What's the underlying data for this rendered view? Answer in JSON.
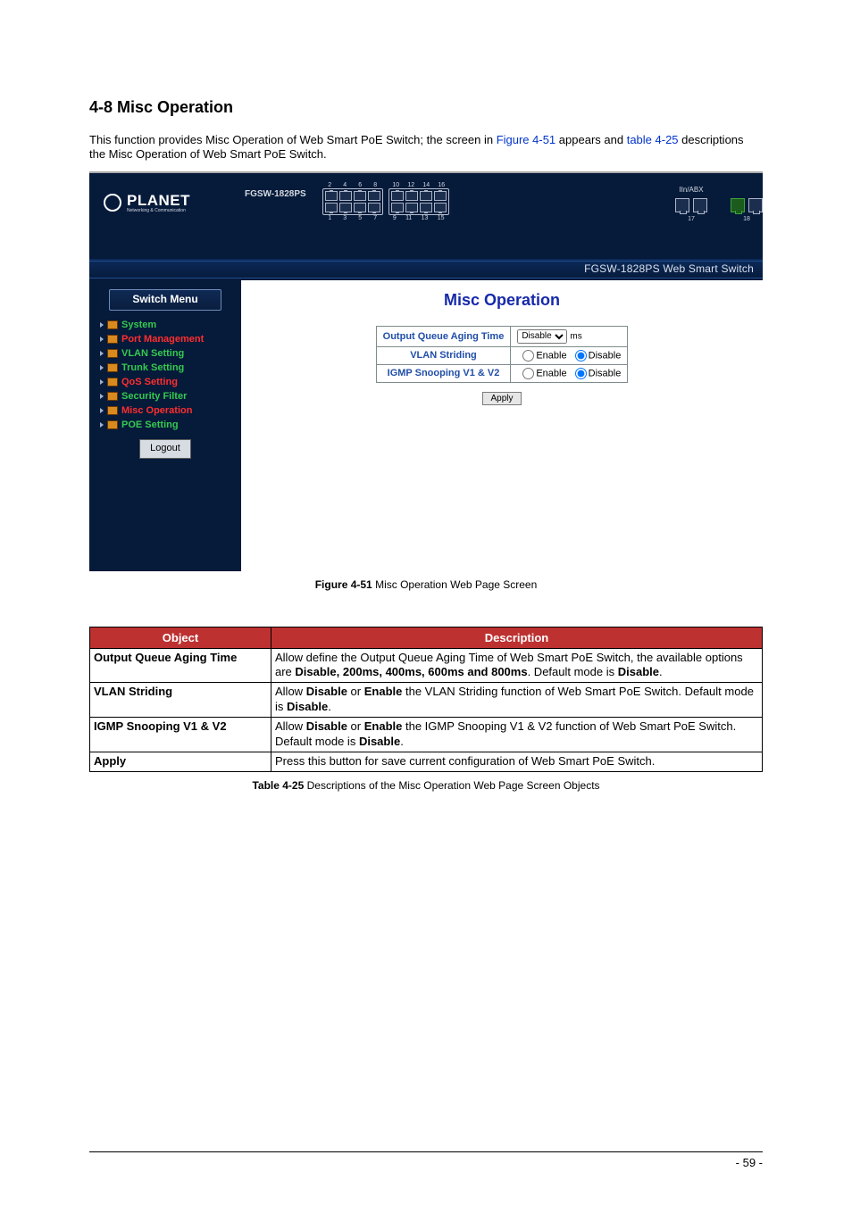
{
  "heading": "4-8 Misc Operation",
  "intro": {
    "before_fig": "This function provides Misc Operation of Web Smart PoE Switch; the screen in ",
    "fig_link": "Figure 4-51",
    "mid": " appears and ",
    "tbl_link": "table 4-25",
    "after": " descriptions the Misc Operation of Web Smart PoE Switch."
  },
  "screenshot": {
    "model": "FGSW-1828PS",
    "brand": "PLANET",
    "brand_sub": "Networking & Communication",
    "link_label": "IIn/ABX",
    "port_nums_top_a": [
      "2",
      "4",
      "6",
      "8"
    ],
    "port_nums_top_b": [
      "10",
      "12",
      "14",
      "16"
    ],
    "port_nums_bot_a": [
      "1",
      "3",
      "5",
      "7"
    ],
    "port_nums_bot_b": [
      "9",
      "11",
      "13",
      "15"
    ],
    "uplink_left": "17",
    "uplink_right": "18",
    "strip_title": "FGSW-1828PS Web Smart Switch",
    "menu_title": "Switch Menu",
    "menu_items": [
      {
        "label": "System",
        "class": "green"
      },
      {
        "label": "Port Management",
        "class": "red"
      },
      {
        "label": "VLAN Setting",
        "class": "green"
      },
      {
        "label": "Trunk Setting",
        "class": "green"
      },
      {
        "label": "QoS Setting",
        "class": "red"
      },
      {
        "label": "Security Filter",
        "class": "green"
      },
      {
        "label": "Misc Operation",
        "class": "red"
      },
      {
        "label": "POE Setting",
        "class": "green"
      }
    ],
    "logout": "Logout",
    "content_title": "Misc Operation",
    "rows": {
      "aging_label": "Output Queue Aging Time",
      "aging_select": "Disable",
      "aging_unit": "ms",
      "vlan_label": "VLAN Striding",
      "igmp_label": "IGMP Snooping V1 & V2",
      "enable": "Enable",
      "disable": "Disable"
    },
    "apply": "Apply"
  },
  "fig_caption_bold": "Figure 4-51",
  "fig_caption_rest": " Misc Operation Web Page Screen",
  "objdesc": {
    "headers": {
      "object": "Object",
      "description": "Description"
    },
    "rows": [
      {
        "object": "Output Queue Aging Time",
        "desc": "Allow define the Output Queue Aging Time of Web Smart PoE Switch, the available options are <b>Disable, 200ms, 400ms, 600ms and 800ms</b>. Default mode is <b>Disable</b>."
      },
      {
        "object": "VLAN Striding",
        "desc": "Allow <b>Disable</b> or <b>Enable</b> the VLAN Striding function of Web Smart PoE Switch. Default mode is <b>Disable</b>."
      },
      {
        "object": "IGMP Snooping V1 & V2",
        "desc": "Allow <b>Disable</b> or <b>Enable</b> the IGMP Snooping V1 & V2 function of Web Smart PoE Switch. Default mode is <b>Disable</b>."
      },
      {
        "object": "Apply",
        "desc": "Press this button for save current configuration of Web Smart PoE Switch."
      }
    ]
  },
  "table_caption_bold": "Table 4-25",
  "table_caption_rest": " Descriptions of the Misc Operation Web Page Screen Objects",
  "page_number": "- 59 -"
}
